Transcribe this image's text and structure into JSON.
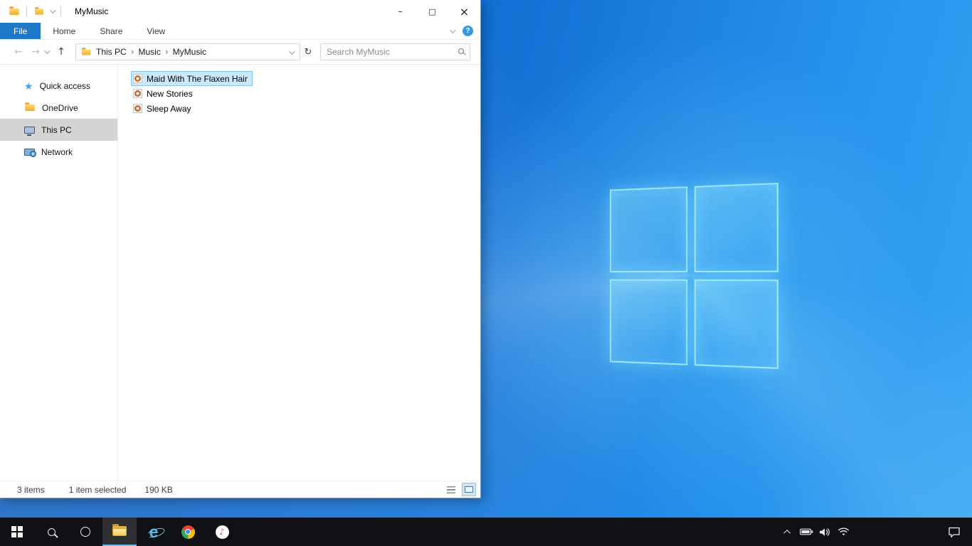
{
  "wallpaper": {
    "base_color": "#1573d6",
    "logo_glow": "#82e1ff"
  },
  "explorer": {
    "title": "MyMusic",
    "window_controls": {
      "minimize": "–",
      "maximize": "□",
      "close": "×"
    },
    "tabs": [
      {
        "label": "File"
      },
      {
        "label": "Home"
      },
      {
        "label": "Share"
      },
      {
        "label": "View"
      }
    ],
    "help_glyph": "?",
    "nav": {
      "back": "←",
      "forward": "→",
      "up": "↑",
      "refresh": "↻"
    },
    "breadcrumb": [
      {
        "label": "This PC"
      },
      {
        "label": "Music"
      },
      {
        "label": "MyMusic"
      }
    ],
    "breadcrumb_sep": "›",
    "search_placeholder": "Search MyMusic",
    "sidebar": [
      {
        "label": "Quick access",
        "selected": false
      },
      {
        "label": "OneDrive",
        "selected": false
      },
      {
        "label": "This PC",
        "selected": true
      },
      {
        "label": "Network",
        "selected": false
      }
    ],
    "files": [
      {
        "name": "Maid With The Flaxen Hair",
        "selected": true
      },
      {
        "name": "New Stories",
        "selected": false
      },
      {
        "name": "Sleep Away",
        "selected": false
      }
    ],
    "status": {
      "items": "3 items",
      "selection": "1 item selected",
      "size": "190 KB"
    }
  },
  "taskbar": {
    "ie_glyph": "e",
    "itunes_glyph": "♪"
  }
}
